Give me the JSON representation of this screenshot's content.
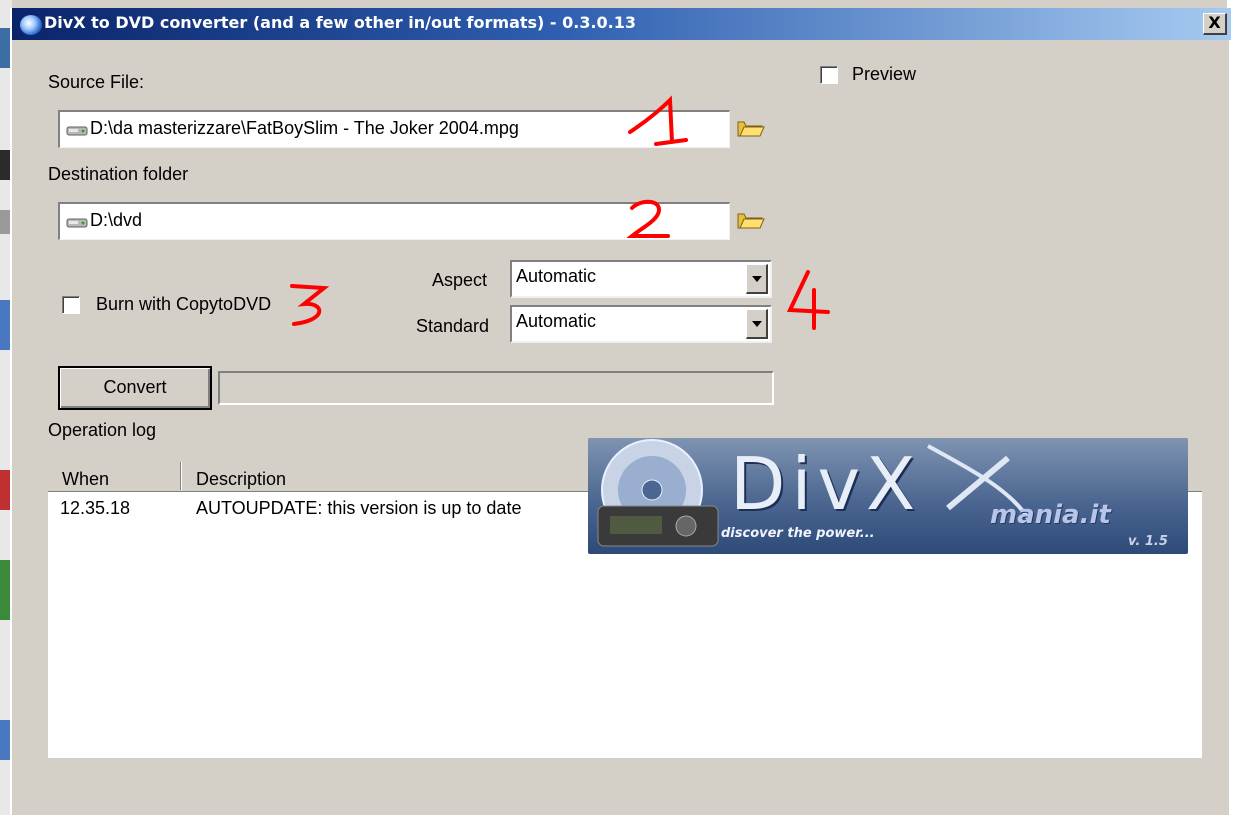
{
  "window": {
    "title": "DivX to DVD converter (and a few other in/out formats) - 0.3.0.13",
    "close_label": "X"
  },
  "source": {
    "label": "Source File:",
    "value": "D:\\da masterizzare\\FatBoySlim - The Joker 2004.mpg"
  },
  "destination": {
    "label": "Destination folder",
    "value": "D:\\dvd"
  },
  "preview": {
    "label": "Preview",
    "checked": false
  },
  "burn": {
    "label": "Burn with CopytoDVD",
    "checked": false
  },
  "aspect": {
    "label": "Aspect",
    "value": "Automatic"
  },
  "standard": {
    "label": "Standard",
    "value": "Automatic"
  },
  "convert_label": "Convert",
  "progress": 0,
  "log": {
    "label": "Operation log",
    "columns": [
      "When",
      "Description"
    ],
    "rows": [
      {
        "when": "12.35.18",
        "description": "AUTOUPDATE: this version is up to date"
      }
    ]
  },
  "banner": {
    "logo": "DivX",
    "tagline": "discover the power...",
    "site": "mania.it",
    "version": "v. 1.5"
  },
  "annotations": [
    "1",
    "2",
    "3",
    "4"
  ],
  "colors": {
    "titlebar_start": "#0a246a",
    "titlebar_end": "#a6caf0",
    "window_bg": "#d4d0c8",
    "annotation_red": "#ff0000"
  },
  "icons": [
    "app-icon",
    "drive-icon",
    "folder-open-icon",
    "dropdown-arrow-icon",
    "close-icon"
  ]
}
